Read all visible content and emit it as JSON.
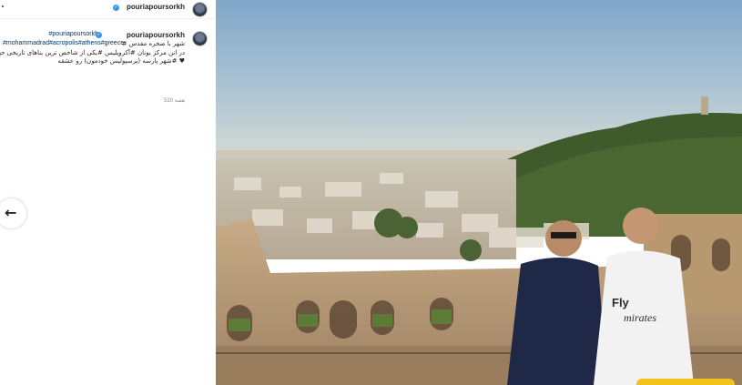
{
  "header": {
    "username": "pouriapoursorkh",
    "menu_dot": "."
  },
  "post": {
    "comment_user": "pouriapoursorkh",
    "mention": "#pouriapoursorkh",
    "caption_lines": [
      "شهر با صخره مقدس #",
      "در اتن مرکز یونان #آکروپلیس #یکی از شاخص ترین بناهای تاریخی جهان",
      "♥ #شهر پارسه (پرسپولیس خودمون) رو عشقه"
    ],
    "hashtags": "#mohammadrad#acropolis#athens#greece",
    "time": "530 هفته"
  },
  "nav": {
    "prev_label": "←"
  },
  "photo": {
    "description_alt": "",
    "shirt_text_line1": "Fly",
    "shirt_text_line2": "mirates"
  },
  "colors": {
    "verified": "#3897f0",
    "link": "#00376b",
    "badge": "#f2c41a"
  }
}
